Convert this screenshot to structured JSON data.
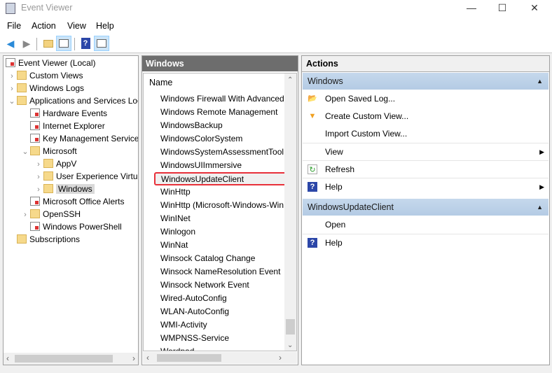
{
  "window": {
    "title": "Event Viewer",
    "minimize": "—",
    "maximize": "☐",
    "close": "✕"
  },
  "menu": [
    "File",
    "Action",
    "View",
    "Help"
  ],
  "toolbar": {
    "back": "back-arrow-icon",
    "forward": "forward-arrow-icon",
    "up": "up-folder-icon",
    "show_hide_tree": "console-tree-icon",
    "help": "help-icon",
    "show_hide_action": "action-pane-icon"
  },
  "tree": {
    "root": "Event Viewer (Local)",
    "items": [
      {
        "label": "Custom Views",
        "level": 1,
        "chevron": "›"
      },
      {
        "label": "Windows Logs",
        "level": 1,
        "chevron": "›"
      },
      {
        "label": "Applications and Services Logs",
        "level": 1,
        "chevron": "⌄"
      },
      {
        "label": "Hardware Events",
        "level": 2,
        "chevron": ""
      },
      {
        "label": "Internet Explorer",
        "level": 2,
        "chevron": ""
      },
      {
        "label": "Key Management Service",
        "level": 2,
        "chevron": ""
      },
      {
        "label": "Microsoft",
        "level": 2,
        "chevron": "⌄"
      },
      {
        "label": "AppV",
        "level": 3,
        "chevron": "›"
      },
      {
        "label": "User Experience Virtualization",
        "level": 3,
        "chevron": "›"
      },
      {
        "label": "Windows",
        "level": 3,
        "chevron": "›",
        "selected": true
      },
      {
        "label": "Microsoft Office Alerts",
        "level": 2,
        "chevron": ""
      },
      {
        "label": "OpenSSH",
        "level": 2,
        "chevron": "›"
      },
      {
        "label": "Windows PowerShell",
        "level": 2,
        "chevron": ""
      },
      {
        "label": "Subscriptions",
        "level": 1,
        "chevron": ""
      }
    ]
  },
  "middle": {
    "header": "Windows",
    "column": "Name",
    "items": [
      "Windows Firewall With Advanced Security",
      "Windows Remote Management",
      "WindowsBackup",
      "WindowsColorSystem",
      "WindowsSystemAssessmentTool",
      "WindowsUIImmersive",
      "WindowsUpdateClient",
      "WinHttp",
      "WinHttp (Microsoft-Windows-WinINet-Config)",
      "WinINet",
      "Winlogon",
      "WinNat",
      "Winsock Catalog Change",
      "Winsock NameResolution Event",
      "Winsock Network Event",
      "Wired-AutoConfig",
      "WLAN-AutoConfig",
      "WMI-Activity",
      "WMPNSS-Service",
      "Wordpad"
    ],
    "highlighted": "WindowsUpdateClient",
    "highlight_color": "#e8303a"
  },
  "actions": {
    "header": "Actions",
    "sections": [
      {
        "title": "Windows",
        "items": [
          {
            "label": "Open Saved Log...",
            "icon": "open-folder-icon"
          },
          {
            "label": "Create Custom View...",
            "icon": "filter-icon"
          },
          {
            "label": "Import Custom View...",
            "icon": ""
          },
          {
            "label": "View",
            "icon": "",
            "submenu": true
          },
          {
            "label": "Refresh",
            "icon": "refresh-icon"
          },
          {
            "label": "Help",
            "icon": "help-icon",
            "submenu": true
          }
        ]
      },
      {
        "title": "WindowsUpdateClient",
        "items": [
          {
            "label": "Open",
            "icon": ""
          },
          {
            "label": "Help",
            "icon": "help-icon"
          }
        ]
      }
    ]
  }
}
